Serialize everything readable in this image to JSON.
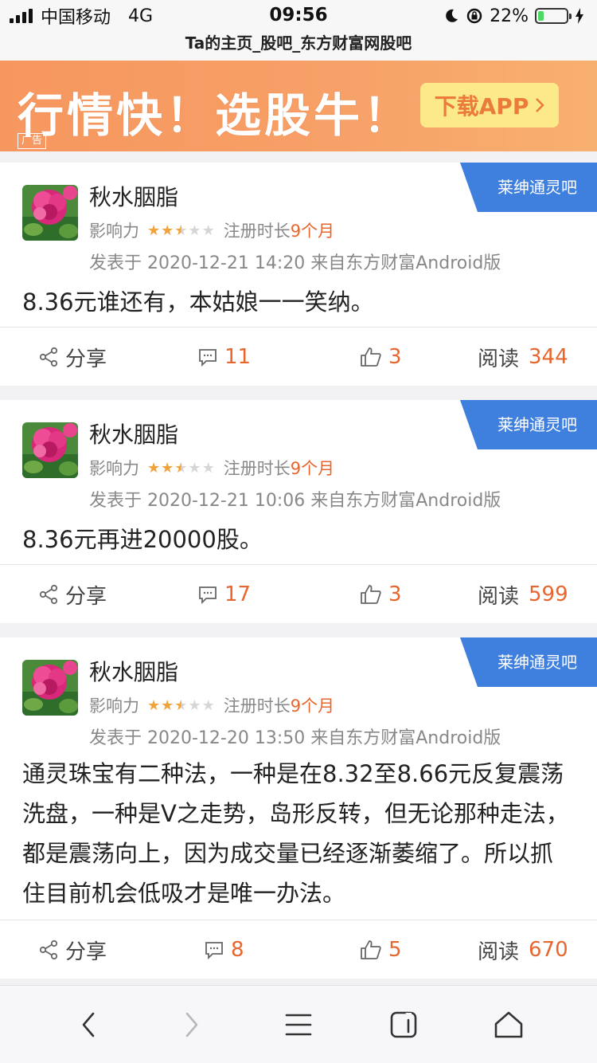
{
  "status_bar": {
    "carrier": "中国移动",
    "network": "4G",
    "time": "09:56",
    "battery": "22%",
    "battery_level": 0.22
  },
  "page_title": "Ta的主页_股吧_东方财富网股吧",
  "ad": {
    "headline": "行情快！选股牛！",
    "button_label": "下载APP",
    "tag": "广告"
  },
  "posts": [
    {
      "username": "秋水胭脂",
      "influence_label": "影响力",
      "stars": 2.5,
      "reg_label": "注册时长",
      "reg_months": "9个月",
      "date_line": "发表于 2020-12-21 14:20  来自东方财富Android版",
      "bar_name": "莱绅通灵吧",
      "content": "8.36元谁还有，本姑娘一一笑纳。",
      "share_label": "分享",
      "comments": "11",
      "likes": "3",
      "read_label": "阅读",
      "reads": "344"
    },
    {
      "username": "秋水胭脂",
      "influence_label": "影响力",
      "stars": 2.5,
      "reg_label": "注册时长",
      "reg_months": "9个月",
      "date_line": "发表于 2020-12-21 10:06  来自东方财富Android版",
      "bar_name": "莱绅通灵吧",
      "content": "8.36元再进20000股。",
      "share_label": "分享",
      "comments": "17",
      "likes": "3",
      "read_label": "阅读",
      "reads": "599"
    },
    {
      "username": "秋水胭脂",
      "influence_label": "影响力",
      "stars": 2.5,
      "reg_label": "注册时长",
      "reg_months": "9个月",
      "date_line": "发表于 2020-12-20 13:50  来自东方财富Android版",
      "bar_name": "莱绅通灵吧",
      "content": "通灵珠宝有二种法，一种是在8.32至8.66元反复震荡洗盘，一种是V之走势，岛形反转，但无论那种走法，都是震荡向上，因为成交量已经逐渐萎缩了。所以抓住目前机会低吸才是唯一办法。",
      "share_label": "分享",
      "comments": "8",
      "likes": "5",
      "read_label": "阅读",
      "reads": "670"
    }
  ],
  "colors": {
    "accent_orange": "#e8662d",
    "badge_blue": "#3f80de",
    "ad_orange": "#f6975f"
  },
  "toolbar_icons": [
    "back-icon",
    "forward-icon",
    "menu-icon",
    "tabs-icon",
    "home-icon"
  ]
}
